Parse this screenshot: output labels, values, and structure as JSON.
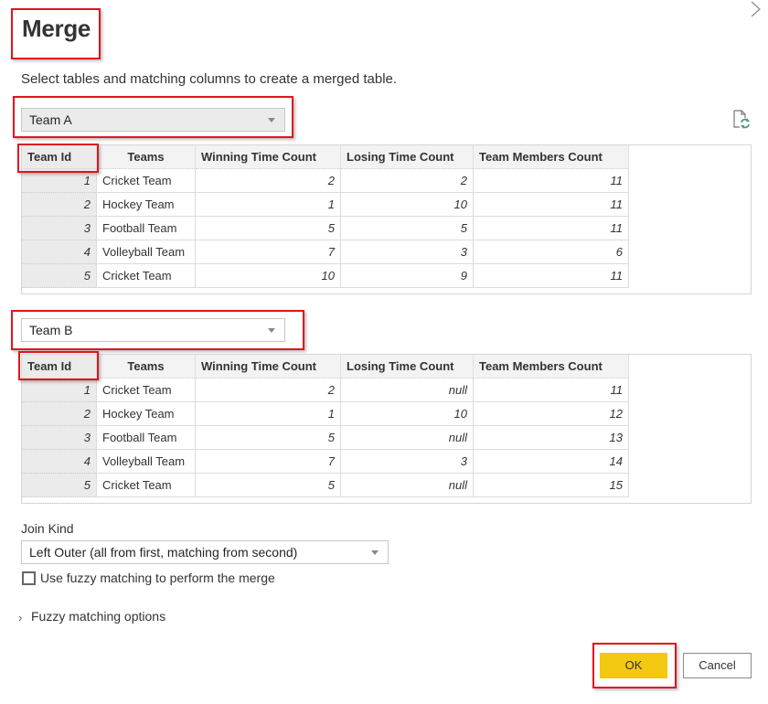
{
  "dialog": {
    "title": "Merge",
    "subtitle": "Select tables and matching columns to create a merged table.",
    "icons": {
      "close": "chevron-right-icon",
      "refresh": "file-refresh-icon"
    }
  },
  "first_table": {
    "selected": "Team A",
    "columns": [
      "Team Id",
      "Teams",
      "Winning Time Count",
      "Losing Time Count",
      "Team Members Count"
    ],
    "rows": [
      [
        "1",
        "Cricket Team",
        "2",
        "2",
        "11"
      ],
      [
        "2",
        "Hockey Team",
        "1",
        "10",
        "11"
      ],
      [
        "3",
        "Football Team",
        "5",
        "5",
        "11"
      ],
      [
        "4",
        "Volleyball Team",
        "7",
        "3",
        "6"
      ],
      [
        "5",
        "Cricket Team",
        "10",
        "9",
        "11"
      ]
    ]
  },
  "second_table": {
    "selected": "Team B",
    "columns": [
      "Team Id",
      "Teams",
      "Winning Time Count",
      "Losing Time Count",
      "Team Members Count"
    ],
    "rows": [
      [
        "1",
        "Cricket Team",
        "2",
        "null",
        "11"
      ],
      [
        "2",
        "Hockey Team",
        "1",
        "10",
        "12"
      ],
      [
        "3",
        "Football Team",
        "5",
        "null",
        "13"
      ],
      [
        "4",
        "Volleyball Team",
        "7",
        "3",
        "14"
      ],
      [
        "5",
        "Cricket Team",
        "5",
        "null",
        "15"
      ]
    ]
  },
  "join": {
    "label": "Join Kind",
    "selected": "Left Outer (all from first, matching from second)"
  },
  "fuzzy": {
    "checkbox_label": "Use fuzzy matching to perform the merge",
    "checked": false,
    "options_label": "Fuzzy matching options"
  },
  "buttons": {
    "ok": "OK",
    "cancel": "Cancel"
  },
  "colors": {
    "ok_button": "#f2c811",
    "highlight": "#e0141e",
    "refresh_accent": "#4f9a7f"
  }
}
